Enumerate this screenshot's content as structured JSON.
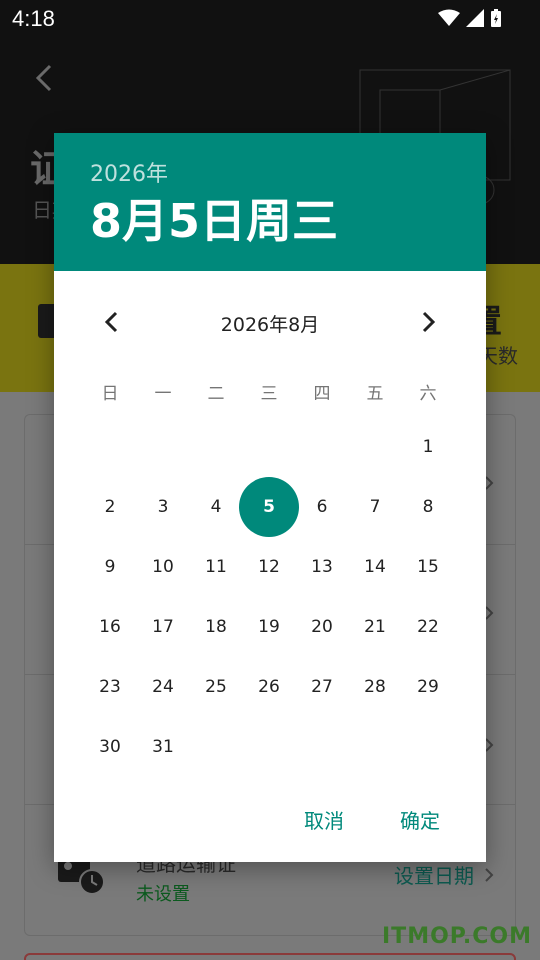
{
  "status_bar": {
    "time": "4:18"
  },
  "background": {
    "page_title": "证",
    "page_subtitle": "日期",
    "banner_title": "置",
    "banner_subtitle": "天数",
    "row_title": "道路运输证",
    "row_status": "未设置",
    "row_action": "设置日期",
    "watermark": "ITMOP.COM"
  },
  "dialog": {
    "header_year": "2026年",
    "header_date": "8月5日周三",
    "month_label": "2026年8月",
    "weekdays": [
      "日",
      "一",
      "二",
      "三",
      "四",
      "五",
      "六"
    ],
    "days": [
      "1",
      "2",
      "3",
      "4",
      "5",
      "6",
      "7",
      "8",
      "9",
      "10",
      "11",
      "12",
      "13",
      "14",
      "15",
      "16",
      "17",
      "18",
      "19",
      "20",
      "21",
      "22",
      "23",
      "24",
      "25",
      "26",
      "27",
      "28",
      "29",
      "30",
      "31"
    ],
    "first_weekday_index": 6,
    "selected_day": "5",
    "cancel_label": "取消",
    "ok_label": "确定"
  },
  "colors": {
    "accent": "#00897b",
    "header_text": "#ffffff",
    "status_text": "#0b5a1e"
  },
  "icons": [
    "chevron-left-icon",
    "chevron-right-icon",
    "wifi-icon",
    "signal-icon",
    "battery-icon",
    "back-arrow-icon",
    "certificate-clock-icon"
  ]
}
